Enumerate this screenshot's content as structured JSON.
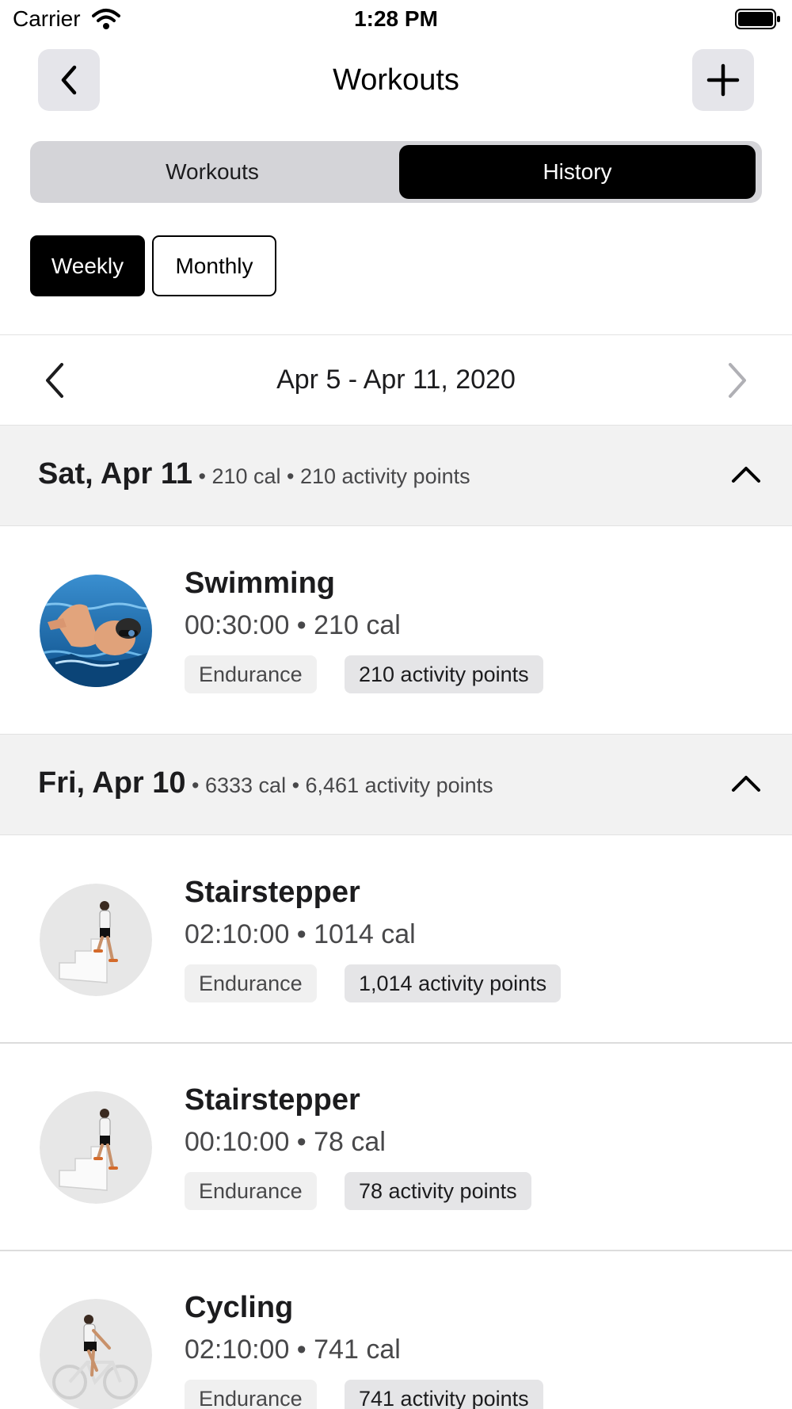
{
  "status": {
    "carrier": "Carrier",
    "time": "1:28 PM"
  },
  "nav": {
    "title": "Workouts"
  },
  "segments": {
    "workouts": "Workouts",
    "history": "History"
  },
  "period": {
    "weekly": "Weekly",
    "monthly": "Monthly"
  },
  "range": {
    "label": "Apr 5 - Apr 11, 2020"
  },
  "days": [
    {
      "title": "Sat, Apr 11",
      "summary": " • 210 cal • 210 activity points",
      "workouts": [
        {
          "name": "Swimming",
          "meta": "00:30:00 • 210 cal",
          "type": "Endurance",
          "points": "210 activity points",
          "icon": "swimmer-photo"
        }
      ]
    },
    {
      "title": "Fri, Apr 10",
      "summary": " • 6333 cal • 6,461 activity points",
      "workouts": [
        {
          "name": "Stairstepper",
          "meta": "02:10:00 • 1014 cal",
          "type": "Endurance",
          "points": "1,014 activity points",
          "icon": "stairstepper-figure"
        },
        {
          "name": "Stairstepper",
          "meta": "00:10:00 • 78 cal",
          "type": "Endurance",
          "points": "78 activity points",
          "icon": "stairstepper-figure"
        },
        {
          "name": "Cycling",
          "meta": "02:10:00 • 741 cal",
          "type": "Endurance",
          "points": "741 activity points",
          "icon": "cyclist-figure"
        }
      ]
    }
  ],
  "colors": {
    "accent": "#000000",
    "header_bg": "#f2f2f2",
    "tag_bg": "#e5e5e7",
    "nav_button_bg": "#e5e5ea"
  }
}
